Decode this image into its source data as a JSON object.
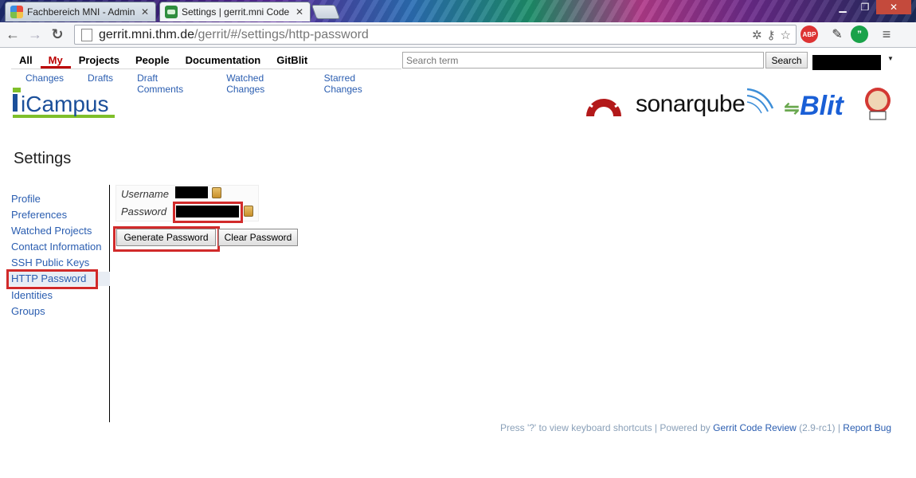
{
  "browser": {
    "tabs": [
      {
        "title": "Fachbereich MNI - Admin",
        "active": false
      },
      {
        "title": "Settings | gerrit.mni Code",
        "active": true
      }
    ],
    "url_domain": "gerrit.mni.thm.de",
    "url_path": "/gerrit/#/settings/http-password",
    "extensions": {
      "abp_label": "ABP",
      "hangouts_label": "”"
    }
  },
  "nav": {
    "menu": [
      {
        "label": "All",
        "selected": false
      },
      {
        "label": "My",
        "selected": true
      },
      {
        "label": "Projects",
        "selected": false
      },
      {
        "label": "People",
        "selected": false
      },
      {
        "label": "Documentation",
        "selected": false
      },
      {
        "label": "GitBlit",
        "selected": false
      }
    ],
    "submenu": [
      "Changes",
      "Drafts",
      "Draft Comments",
      "Watched Changes",
      "Starred Changes"
    ],
    "search_placeholder": "Search term",
    "search_button": "Search"
  },
  "logos": {
    "icampus": "iCampus",
    "sonarqube": "sonarqube",
    "gitblit": "Blit"
  },
  "page": {
    "title": "Settings",
    "sidebar": [
      {
        "label": "Profile",
        "active": false
      },
      {
        "label": "Preferences",
        "active": false
      },
      {
        "label": "Watched Projects",
        "active": false
      },
      {
        "label": "Contact Information",
        "active": false
      },
      {
        "label": "SSH Public Keys",
        "active": false
      },
      {
        "label": "HTTP Password",
        "active": true
      },
      {
        "label": "Identities",
        "active": false
      },
      {
        "label": "Groups",
        "active": false
      }
    ],
    "form": {
      "username_label": "Username",
      "password_label": "Password"
    },
    "buttons": {
      "generate": "Generate Password",
      "clear": "Clear Password"
    }
  },
  "footer": {
    "shortcuts": "Press '?' to view keyboard shortcuts | Powered by",
    "product": "Gerrit Code Review",
    "version": "(2.9-rc1) |",
    "report_bug": "Report Bug"
  },
  "colors": {
    "link": "#2a5db0",
    "selected_menu": "#bb0000",
    "highlight": "#d12a2a"
  }
}
